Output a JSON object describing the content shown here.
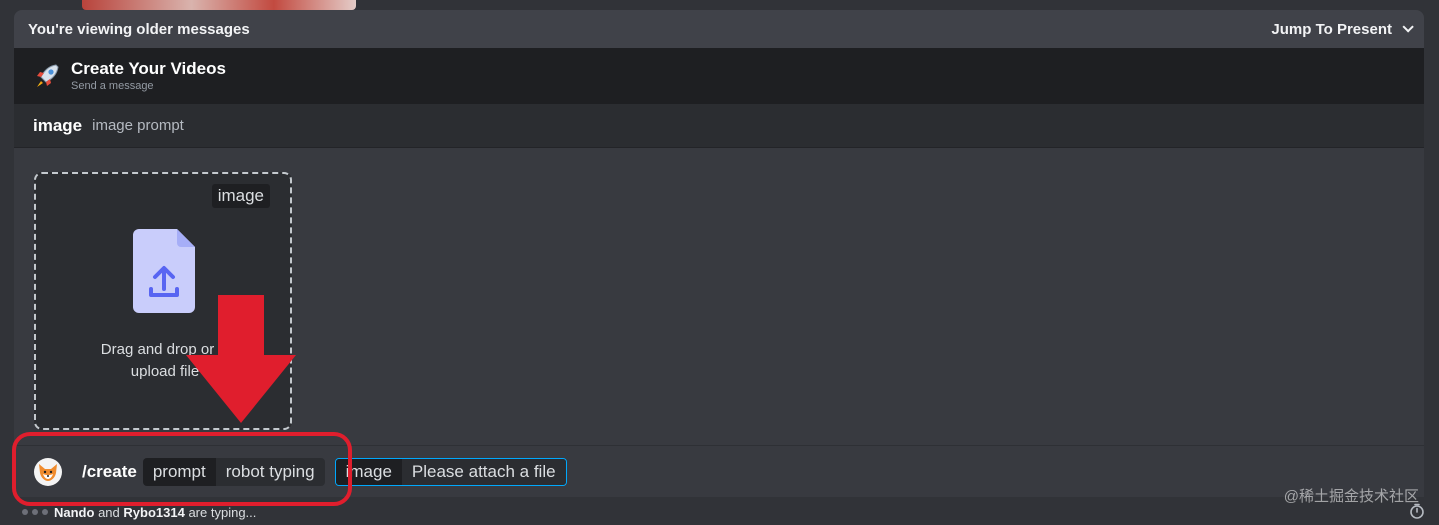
{
  "banner": {
    "older_text": "You're viewing older messages",
    "jump_label": "Jump To Present"
  },
  "command": {
    "title": "Create Your Videos",
    "subtitle": "Send a message"
  },
  "option": {
    "name": "image",
    "description": "image prompt"
  },
  "dropzone": {
    "tag": "image",
    "line1": "Drag and drop or cl",
    "line2": "upload file"
  },
  "input": {
    "command": "/create",
    "params": [
      {
        "key": "prompt",
        "value": "robot typing"
      },
      {
        "key": "image",
        "value": "Please attach a file"
      }
    ]
  },
  "typing": {
    "user1": "Nando",
    "conj": "and",
    "user2": "Rybo1314",
    "suffix": "are typing..."
  },
  "watermark": "@稀土掘金技术社区",
  "icons": [
    "chevron-down-icon",
    "rocket-icon",
    "upload-file-icon",
    "arrow-down-icon",
    "timer-icon"
  ],
  "colors": {
    "accent_blue": "#00a8fc",
    "highlight_red": "#e01e2d",
    "upload_icon_bg": "#c9cdfb",
    "upload_icon_fg": "#5865f2"
  }
}
